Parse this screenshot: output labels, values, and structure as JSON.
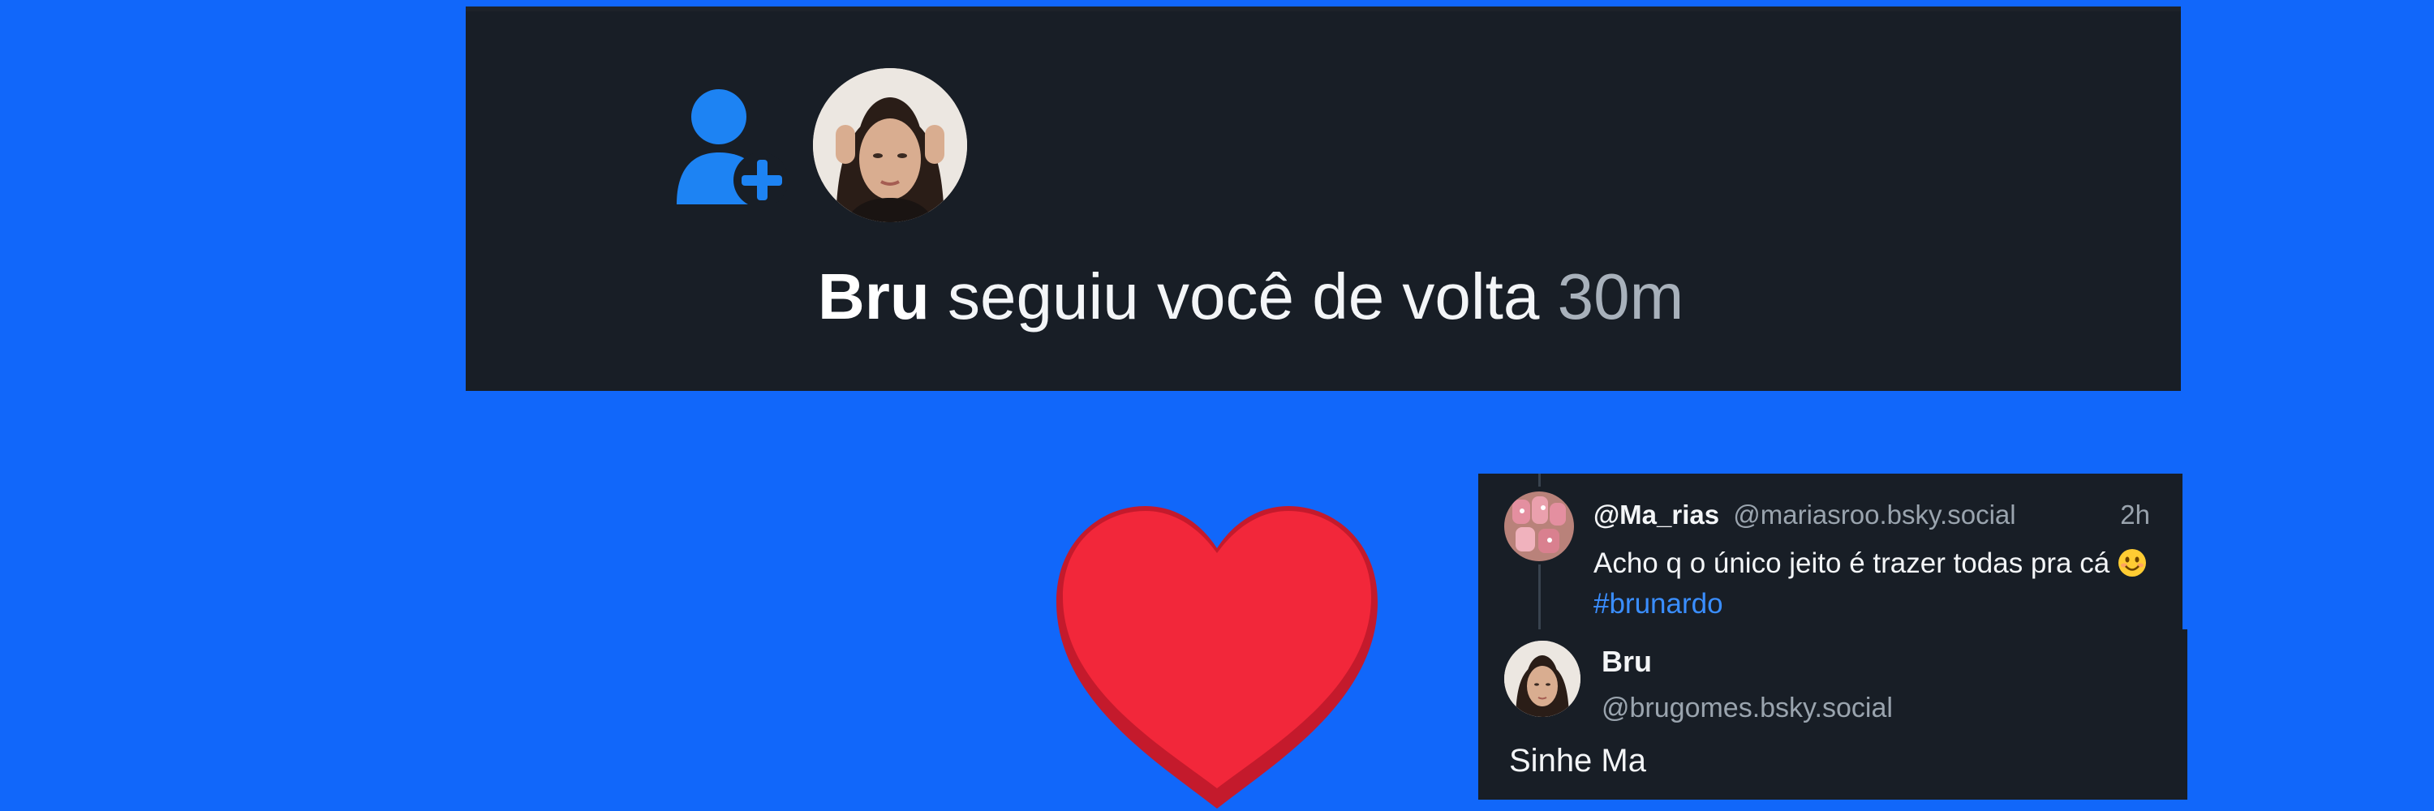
{
  "colors": {
    "background": "#1167fa",
    "card": "#181e26",
    "accent": "#1d83f3",
    "hashtag": "#3a8eff",
    "heart": "#f2273a"
  },
  "notification": {
    "icon": "follow-user-plus-icon",
    "name": "Bru",
    "action": "seguiu você de volta",
    "time": "30m"
  },
  "decoration": {
    "icon": "red-heart-icon"
  },
  "post": {
    "author": "@Ma_rias",
    "handle": "@mariasroo.bsky.social",
    "time": "2h",
    "text": "Acho q o único jeito é trazer todas pra cá",
    "emoji": "smiling-face-emoji",
    "hashtag": "#brunardo"
  },
  "reply": {
    "author": "Bru",
    "handle": "@brugomes.bsky.social",
    "text": "Sinhe Ma"
  }
}
